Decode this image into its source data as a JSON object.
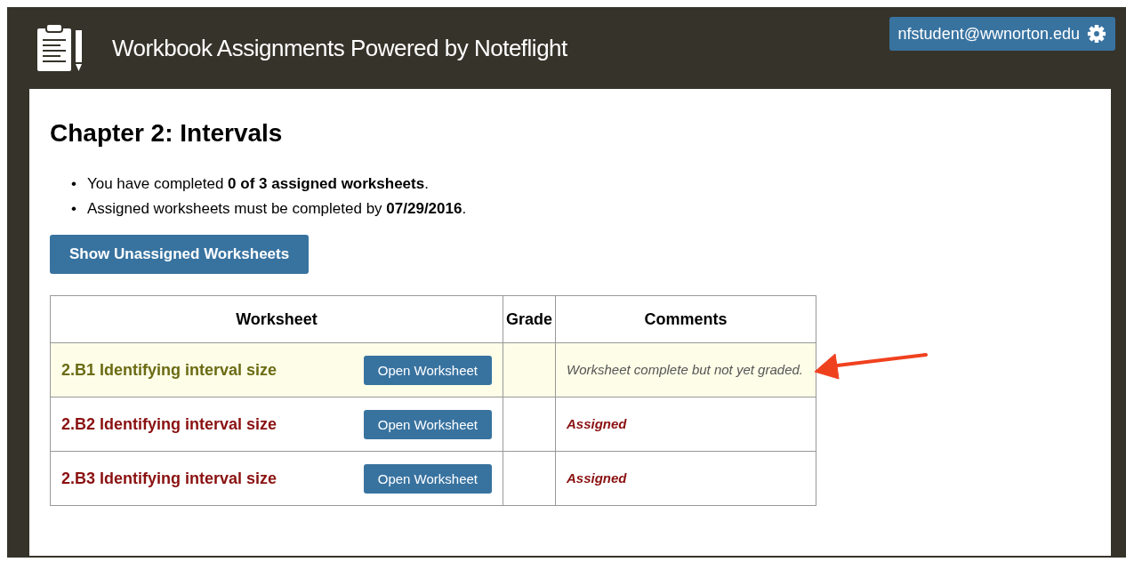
{
  "header": {
    "title": "Workbook Assignments Powered by Noteflight",
    "user": "nfstudent@wwnorton.edu"
  },
  "heading": "Chapter 2: Intervals",
  "bullets": [
    {
      "marker": "•",
      "text": "You have completed **0 of 3 assigned worksheets**."
    },
    {
      "marker": "•",
      "text": "Assigned worksheets must be completed by **07/29/2016**."
    }
  ],
  "toggle_button": "Show Unassigned Worksheets",
  "table": {
    "columns": [
      "Worksheet",
      "Grade",
      "Comments"
    ],
    "rows": [
      {
        "worksheet": "2.B1 Identifying interval size",
        "button": "Open Worksheet",
        "kind": "complete",
        "comment": "Worksheet complete but not yet graded."
      },
      {
        "worksheet": "2.B2 Identifying interval size",
        "button": "Open Worksheet",
        "kind": "assigned",
        "comment": "Assigned"
      },
      {
        "worksheet": "2.B3 Identifying interval size",
        "button": "Open Worksheet",
        "kind": "assigned",
        "comment": "Assigned"
      }
    ]
  }
}
